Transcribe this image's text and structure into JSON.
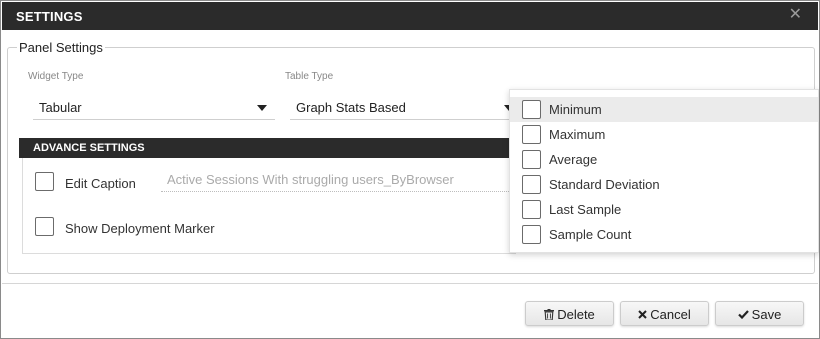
{
  "dialog": {
    "title": "SETTINGS",
    "close_glyph": "✕"
  },
  "panel": {
    "legend": "Panel Settings",
    "widget_type": {
      "label": "Widget Type",
      "value": "Tabular"
    },
    "table_type": {
      "label": "Table Type",
      "value": "Graph Stats Based"
    }
  },
  "advance": {
    "title": "ADVANCE SETTINGS",
    "edit_caption": {
      "label": "Edit Caption",
      "checked": false,
      "placeholder": "Active Sessions With struggling users_ByBrowser"
    },
    "deployment_marker": {
      "label": "Show Deployment Marker",
      "checked": false
    }
  },
  "stats_dropdown": {
    "options": [
      {
        "label": "Minimum",
        "checked": false,
        "highlighted": true
      },
      {
        "label": "Maximum",
        "checked": false
      },
      {
        "label": "Average",
        "checked": false
      },
      {
        "label": "Standard Deviation",
        "checked": false
      },
      {
        "label": "Last Sample",
        "checked": false
      },
      {
        "label": "Sample Count",
        "checked": false
      }
    ]
  },
  "footer": {
    "delete_label": "Delete",
    "cancel_label": "Cancel",
    "save_label": "Save",
    "delete_icon": "trash-icon",
    "cancel_icon": "x-icon",
    "save_icon": "check-icon"
  },
  "colors": {
    "titlebar": "#2b2b2b",
    "highlight": "#ebebeb"
  }
}
